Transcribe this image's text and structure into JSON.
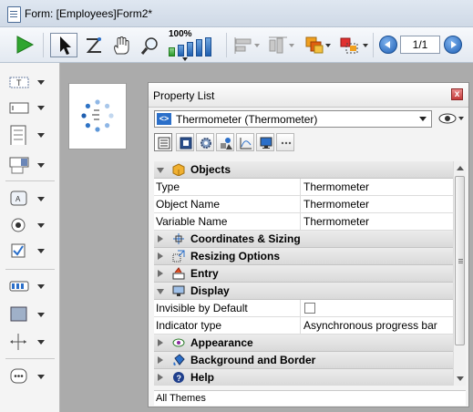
{
  "window": {
    "title": "Form: [Employees]Form2*"
  },
  "toolbar": {
    "zoom_label": "100%",
    "page_indicator": "1/1"
  },
  "property_list": {
    "title": "Property List",
    "close_label": "x",
    "object_selector": "Thermometer (Thermometer)",
    "object_selector_icon_text": "<>",
    "groups_top": {
      "objects": "Objects"
    },
    "rows_objects": [
      {
        "name": "Type",
        "value": "Thermometer"
      },
      {
        "name": "Object Name",
        "value": "Thermometer"
      },
      {
        "name": "Variable Name",
        "value": "Thermometer"
      }
    ],
    "group_labels": {
      "coordinates": "Coordinates & Sizing",
      "resizing": "Resizing Options",
      "entry": "Entry",
      "display": "Display",
      "appearance": "Appearance",
      "background": "Background and Border",
      "help": "Help"
    },
    "rows_display": [
      {
        "name": "Invisible by Default",
        "checked": false
      },
      {
        "name": "Indicator type",
        "value": "Asynchronous progress bar"
      }
    ],
    "themes_label": "All Themes"
  },
  "colors": {
    "accent": "#1f5fb0",
    "play_green": "#2fa52f",
    "close_red": "#c53a3a"
  }
}
